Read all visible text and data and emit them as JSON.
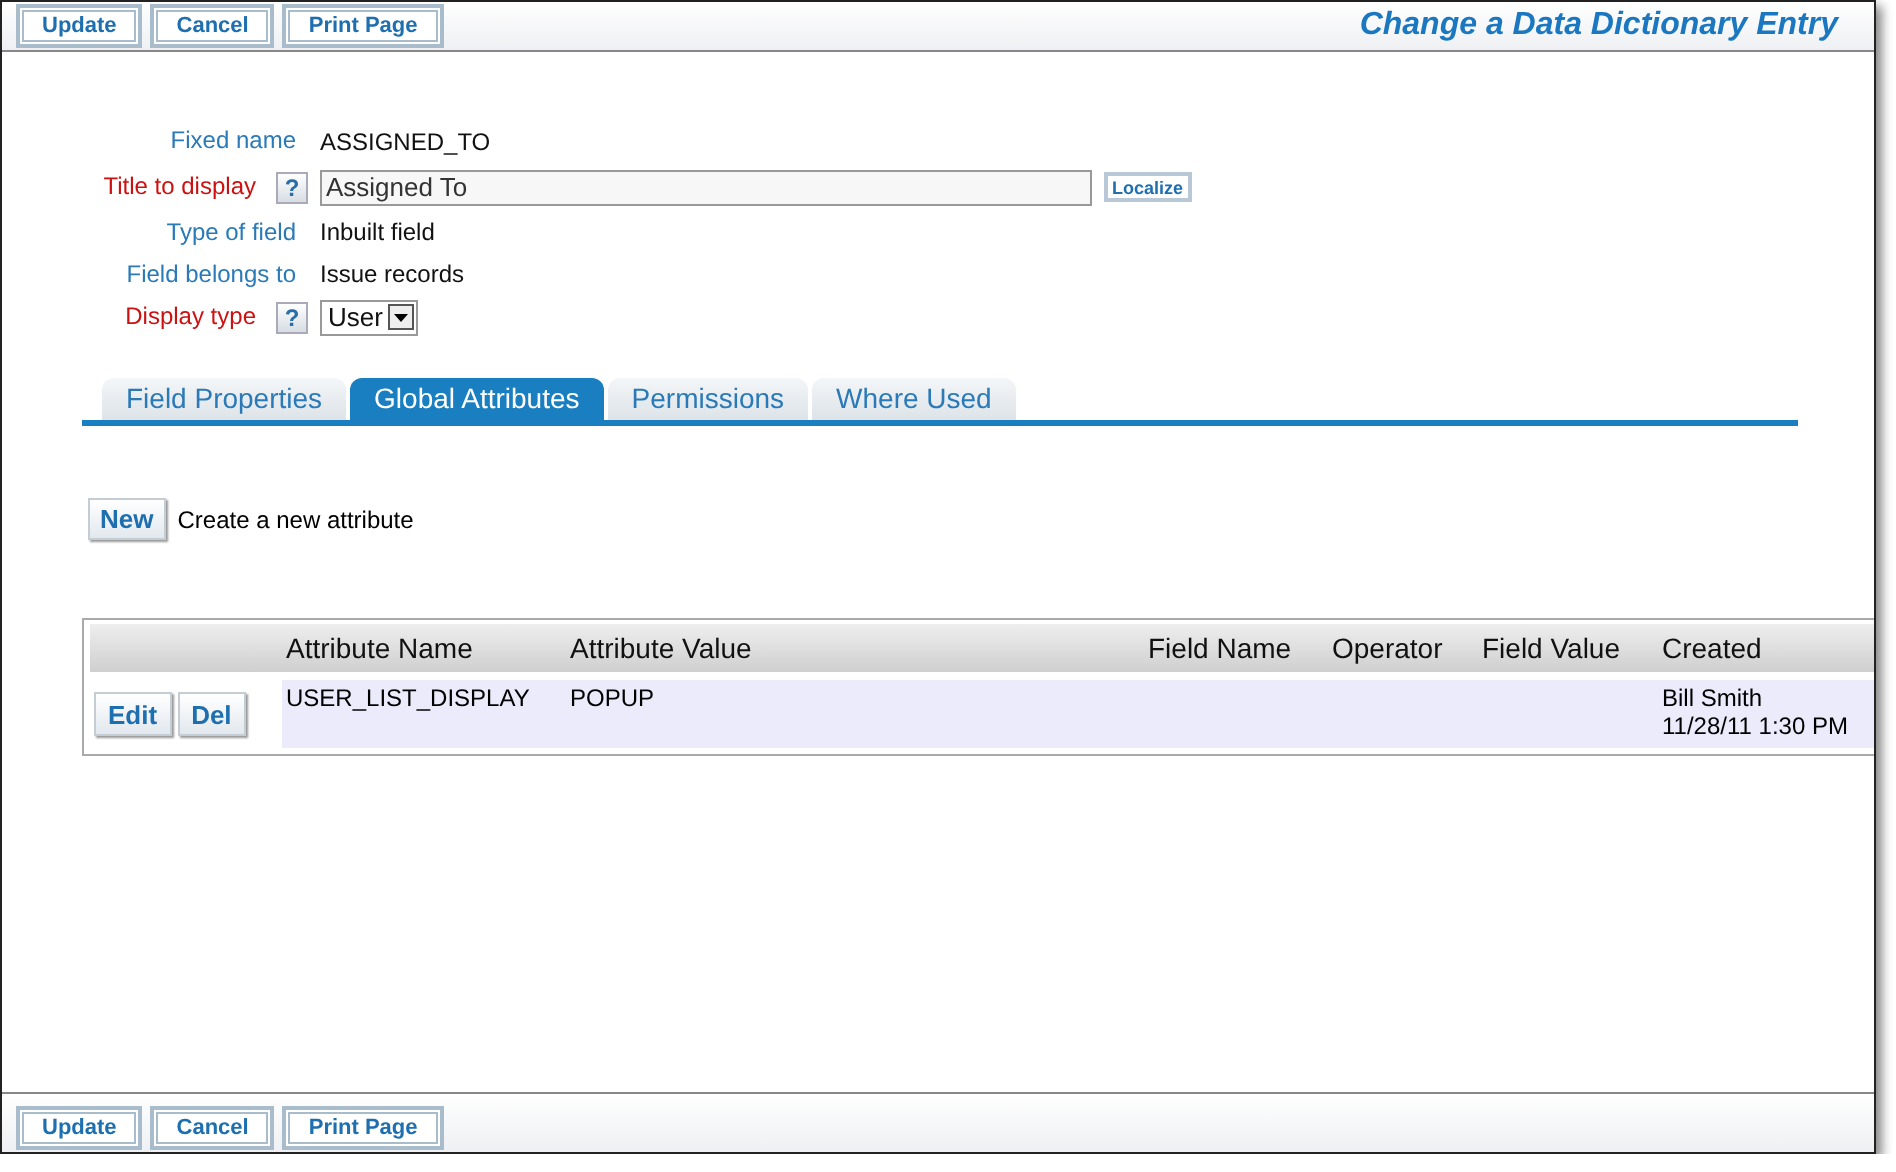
{
  "top_toolbar": {
    "buttons": [
      "Update",
      "Cancel",
      "Print Page"
    ]
  },
  "page_title": "Change a Data Dictionary Entry",
  "fields": [
    {
      "label": "Fixed name",
      "required": false,
      "kind": "text",
      "value": "ASSIGNED_TO"
    },
    {
      "label": "Title to display",
      "required": true,
      "kind": "input",
      "help": "?",
      "value": "Assigned To",
      "action": "Localize"
    },
    {
      "label": "Type of field",
      "required": false,
      "kind": "text",
      "value": "Inbuilt field"
    },
    {
      "label": "Field belongs to",
      "required": false,
      "kind": "text",
      "value": "Issue records"
    },
    {
      "label": "Display type",
      "required": true,
      "kind": "select",
      "help": "?",
      "value": "User"
    }
  ],
  "tabs": [
    {
      "label": "Field Properties",
      "selected": false
    },
    {
      "label": "Global Attributes",
      "selected": true
    },
    {
      "label": "Permissions",
      "selected": false
    },
    {
      "label": "Where Used",
      "selected": false
    }
  ],
  "new_button": "New",
  "new_hint": "Create a new attribute",
  "table": {
    "columns": [
      "Attribute Name",
      "Attribute Value",
      "Field Name",
      "Operator",
      "Field Value",
      "Created"
    ],
    "rows": [
      {
        "actions": [
          "Edit",
          "Del"
        ],
        "cells": [
          "USER_LIST_DISPLAY",
          "POPUP",
          "",
          "",
          "",
          ""
        ],
        "created_by": "Bill Smith",
        "created_at": "11/28/11 1:30 PM"
      }
    ]
  },
  "bottom_toolbar": {
    "buttons": [
      "Update",
      "Cancel",
      "Print Page"
    ]
  }
}
